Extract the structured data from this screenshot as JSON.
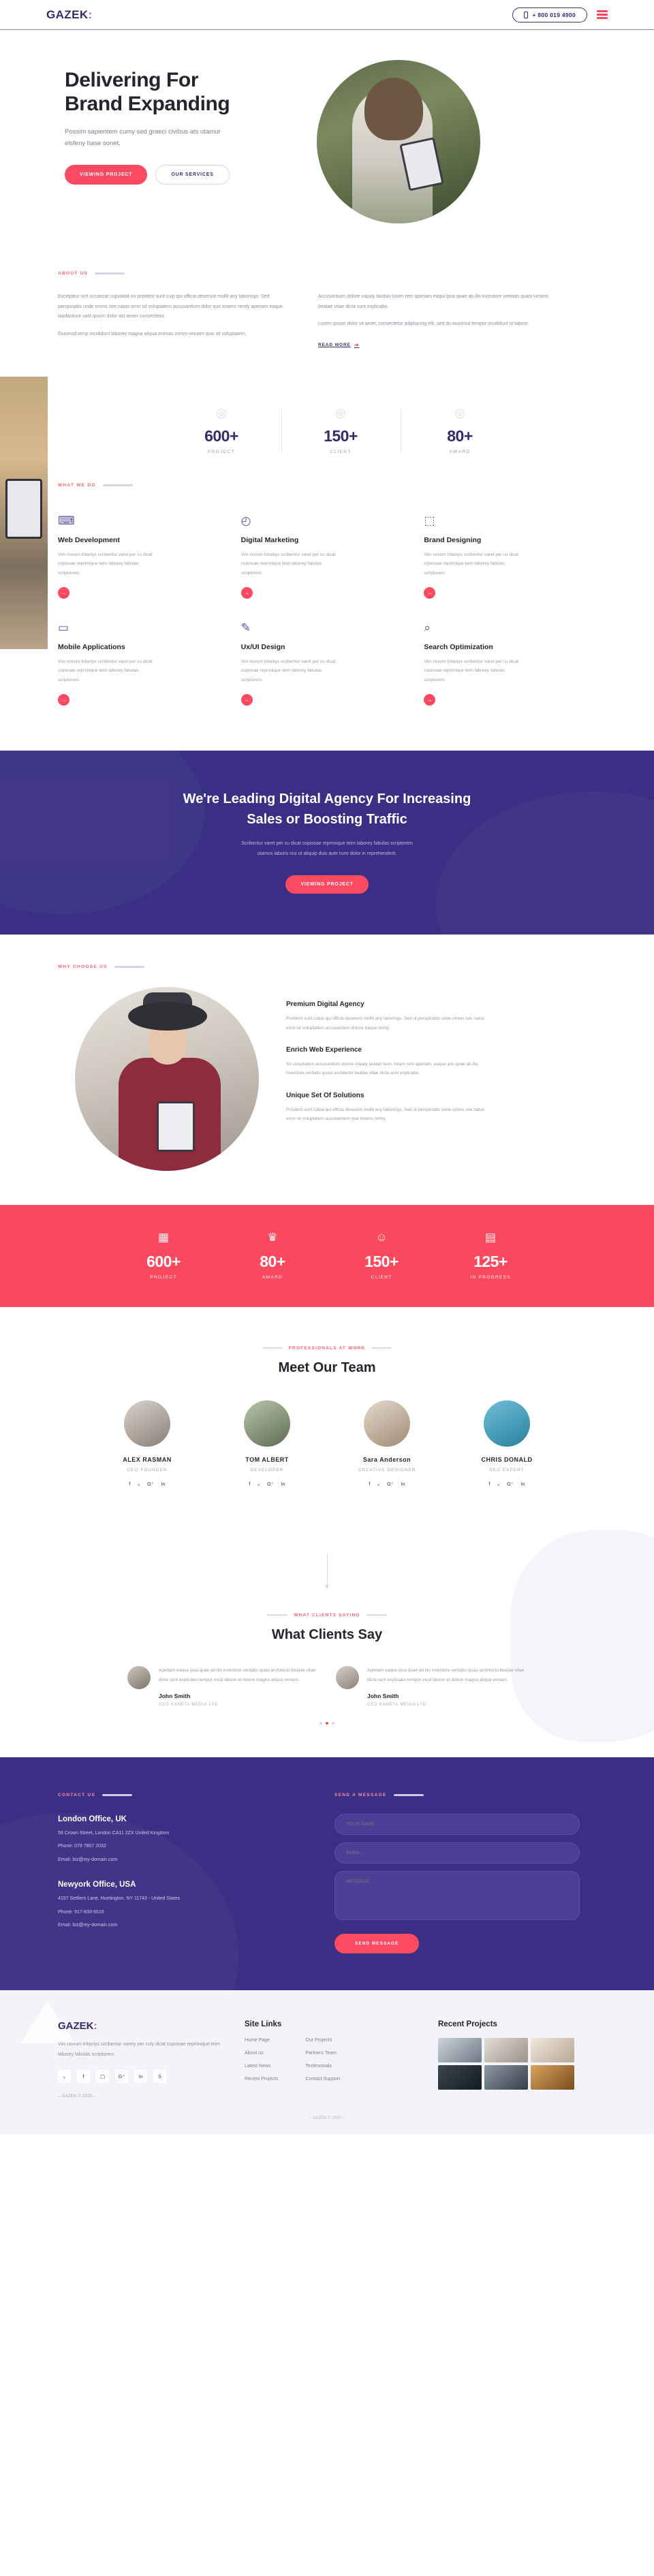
{
  "header": {
    "brand": "GAZEK",
    "brand_dot": ":",
    "phone": "+ 800 019 4900",
    "phone_icon": "mobile-phone-icon",
    "menu_icon": "hamburger-menu-icon"
  },
  "hero": {
    "title_line1": "Delivering For",
    "title_line2": "Brand Expanding",
    "paragraph": "Possim sapientem cumy sed graeci clvibus ats utamur elsfeny hase sonet.",
    "btn_primary": "VIEWING PROJECT",
    "btn_secondary": "OUR SERVICES"
  },
  "about": {
    "tag": "ABOUT US",
    "col1_p1": "Excepteur sint occaecat cupidatat no proident sunt culp qui officia deserunt mollit any laborings. Sed perspiciatis unde omnis iste natus error sit voluptatem accusantium dolor que totams remly aperiam eaque laudantium vast ipsum dolor ast amen consectetur.",
    "col1_p2": "Eiusmod temp incididunt laborey magna aliqua enimas minim veniam quis sit voluptatem.",
    "col2_p1": "Accusantium dolore inipaly laudan totam rem aperiam eaqui ipsa quae ab illo inventore veritatis quasi victoris beatae vitae dicta sunt explicabo.",
    "col2_p2": "Lorem ipsum dolor sit amet, consectetur adipisicing elit, sed do eiusmod tempor incididunt ut labore.",
    "read_more": "READ MORE"
  },
  "counters_light": [
    {
      "icon": "globe-pin-icon",
      "number": "600+",
      "label": "PROJECT"
    },
    {
      "icon": "award-badge-icon",
      "number": "150+",
      "label": "CLIENT"
    },
    {
      "icon": "location-pin-icon",
      "number": "80+",
      "label": "AWARD"
    }
  ],
  "services": {
    "tag": "WHAT WE DO",
    "cards": [
      {
        "icon": "web-development-icon",
        "glyph": "⌨",
        "title": "Web Development",
        "text": "Vim novum tritaniys scribentur varet per cu dicat copiosae reprimique teim laborey fabulas scriptorem.",
        "arrow": "→"
      },
      {
        "icon": "digital-marketing-icon",
        "glyph": "◴",
        "title": "Digital Marketing",
        "text": "Vim novum tritaniys scribentur varet per cu dicat copiosae reprimique teim laborey fabulas scriptorem.",
        "arrow": "→"
      },
      {
        "icon": "brand-designing-icon",
        "glyph": "⬚",
        "title": "Brand Designing",
        "text": "Vim novum tritaniys scribentur varet per cu dicat copiosae reprimique teim laborey fabulas scriptorem.",
        "arrow": "→"
      },
      {
        "icon": "mobile-applications-icon",
        "glyph": "▭",
        "title": "Mobile Applications",
        "text": "Vim novum tritaniys scribentur varet per cu dicat copiosae reprimique teim laborey fabulas scriptorem.",
        "arrow": "→"
      },
      {
        "icon": "ux-ui-design-icon",
        "glyph": "✎",
        "title": "Ux/UI Design",
        "text": "Vim novum tritaniys scribentur varet per cu dicat copiosae reprimique teim laborey fabulas scriptorem.",
        "arrow": "→"
      },
      {
        "icon": "search-optimization-icon",
        "glyph": "⌕",
        "title": "Search Optimization",
        "text": "Vim novum tritaniys scribentur varet per cu dicat copiosae reprimique teim laborey fabulas scriptorem.",
        "arrow": "→"
      }
    ]
  },
  "purple_cta": {
    "title_line1": "We're Leading Digital Agency For Increasing",
    "title_line2": "Sales or Boosting Traffic",
    "paragraph_line1": "Scribentur varet per cu dicat copiosae reprimique teim laborey fabulas scriptorem",
    "paragraph_line2": "utamos laboris nisi ut aliquip duis aute irure dolor in reprehenderit.",
    "button": "VIEWING PROJECT"
  },
  "why": {
    "tag": "WHY CHOOSE US",
    "items": [
      {
        "title": "Premium Digital Agency",
        "text": "Proident sunt culpa qui officia deserunt mollit any laborings. Sed ut perspiciatis unde omnis iste natus error sit voluptatem accusantium dolore itaque remly."
      },
      {
        "title": "Enrich Web Experience",
        "text": "Sit voluptatem accusantium dolore inipaly laudan tium, totam rem aperiam, eaque ipsi quae ab illo inventore veritatis quasi architecto beatae vitae dicta sunt explicabo."
      },
      {
        "title": "Unique Set Of Solutions",
        "text": "Proident sunt culpa qui officia deserunt mollit any laborings. Sed ut perspiciatis unde omnis iste natus error sit voluptatem accusantium qua totams remly."
      }
    ]
  },
  "red_stats": [
    {
      "icon": "projects-icon",
      "number": "600+",
      "label": "PROJECT"
    },
    {
      "icon": "trophy-icon",
      "number": "80+",
      "label": "AWARD"
    },
    {
      "icon": "client-user-icon",
      "number": "150+",
      "label": "CLIENT"
    },
    {
      "icon": "in-progress-icon",
      "number": "125+",
      "label": "IN PROGRESS"
    }
  ],
  "team": {
    "tag": "PROFESSIONALS AT WORK",
    "title": "Meet Our Team",
    "members": [
      {
        "avatar": "avatar-alex-rasman",
        "name": "ALEX RASMAN",
        "role": "CEO FOUNDER",
        "socials": [
          "facebook-icon",
          "twitter-icon",
          "google-plus-icon",
          "linkedin-icon"
        ]
      },
      {
        "avatar": "avatar-tom-albert",
        "name": "TOM ALBERT",
        "role": "DEVELOPER",
        "socials": [
          "facebook-icon",
          "twitter-icon",
          "google-plus-icon",
          "linkedin-icon"
        ]
      },
      {
        "avatar": "avatar-sara-anderson",
        "name": "Sara Anderson",
        "role": "CREATIVE DESIGNER",
        "socials": [
          "facebook-icon",
          "twitter-icon",
          "google-plus-icon",
          "linkedin-icon"
        ]
      },
      {
        "avatar": "avatar-chris-donald",
        "name": "CHRIS DONALD",
        "role": "SEO EXPERT",
        "socials": [
          "facebook-icon",
          "twitter-icon",
          "google-plus-icon",
          "linkedin-icon"
        ]
      }
    ]
  },
  "testimonials": {
    "tag": "WHAT CLIENTS SAYING",
    "title": "What Clients Say",
    "cards": [
      {
        "avatar": "testimonial-avatar-1",
        "quote": "Aperiam eaque ipsa quae ab illo inventore veritatis quasi architecto beatae vitae dicta sunt explicabo tempor incid labore et dolore magna aliqua veniam.",
        "name": "John Smith",
        "role": "CEO KANETA MEDIA LTD"
      },
      {
        "avatar": "testimonial-avatar-2",
        "quote": "Aperiam eaque ipsa quae ab illo inventore veritatis quasi architecto beatae vitae dicta sunt explicabo tempor incid labore et dolore magna aliqua veniam.",
        "name": "John Smith",
        "role": "CEO KANETA MEDIA LTD"
      }
    ],
    "dots": 3,
    "active_dot": 1
  },
  "contact": {
    "tag": "CONTACT US",
    "form_tag": "SEND A MESSAGE",
    "offices": [
      {
        "name": "London Office, UK",
        "address": "58 Crown Street, London CA11 2ZX United Kingdom",
        "phone": "Phone: 079 7807 2032",
        "email": "Email: biz@my-domain.com"
      },
      {
        "name": "Newyork Office, USA",
        "address": "4157 Settlers Lane, Huntington, NY 11743 - United States",
        "phone": "Phone: 917-833-6516",
        "email": "Email: biz@my-domain.com"
      }
    ],
    "placeholder_name": "YOUR NAME",
    "placeholder_email": "EMAIL...",
    "placeholder_message": "MESSAGE",
    "send_button": "SEND MESSAGE"
  },
  "footer": {
    "brand": "GAZEK",
    "brand_dot": ":",
    "about": "Vim novum tritaniys scribentur varety per culy dicat copiosae reprimique teim laborey fabulas scriptorem.",
    "socials": [
      "twitter-icon",
      "facebook-icon",
      "instagram-icon",
      "google-plus-icon",
      "linkedin-icon",
      "skype-icon"
    ],
    "copyright": "– GAZEK © 2020 –",
    "links_heading": "Site Links",
    "links_col1": [
      "Home Page",
      "About us",
      "Latest News",
      "Recent Projects"
    ],
    "links_col2": [
      "Our Projects",
      "Partners Team",
      "Testimonials",
      "Contact Support"
    ],
    "projects_heading": "Recent Projects",
    "thumbs": [
      "project-thumb-1",
      "project-thumb-2",
      "project-thumb-3",
      "project-thumb-4",
      "project-thumb-5",
      "project-thumb-6"
    ],
    "bottom": "– GAZEK © 2020 –"
  },
  "colors": {
    "accent_red": "#fb4a5f",
    "brand_purple": "#342b6b",
    "deep_purple": "#3a2f85",
    "muted_text": "#9a9aa8"
  }
}
